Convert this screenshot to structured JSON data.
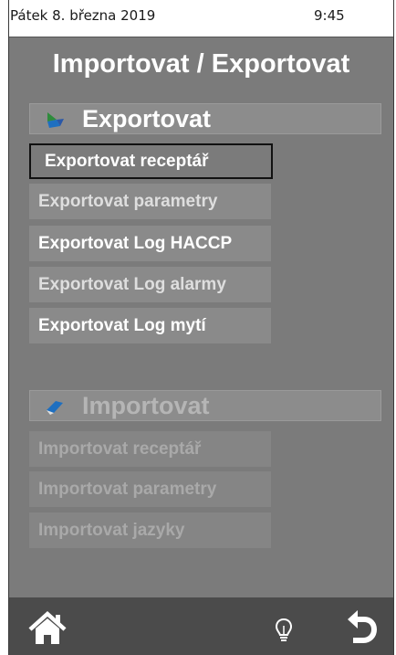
{
  "status": {
    "date": "Pátek 8. března 2019",
    "time": "9:45"
  },
  "title": "Importovat / Exportovat",
  "export": {
    "header": "Exportovat",
    "buttons": [
      "Exportovat receptář",
      "Exportovat parametry",
      "Exportovat Log HACCP",
      "Exportovat Log alarmy",
      "Exportovat Log mytí"
    ]
  },
  "import": {
    "header": "Importovat",
    "buttons": [
      "Importovat receptář",
      "Importovat parametry",
      "Importovat jazyky"
    ]
  },
  "nav": {
    "home": "home-icon",
    "tip": "lightbulb-icon",
    "back": "back-arrow-icon"
  },
  "colors": {
    "background": "#7b7b7b",
    "bar": "#4b4b4b",
    "accent_green": "#2e8b3c",
    "accent_blue": "#1e6fc0"
  }
}
